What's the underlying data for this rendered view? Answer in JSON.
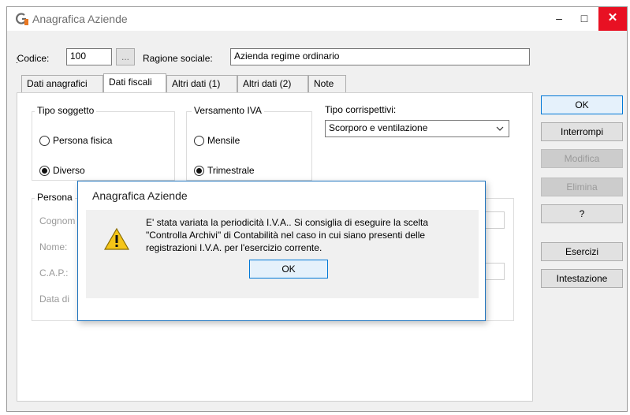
{
  "window": {
    "title": "Anagrafica Aziende",
    "app_logo": "G",
    "minimize": "–",
    "maximize": "□",
    "close": "✕"
  },
  "header": {
    "code_label": "Codice:",
    "code_value": "100",
    "lookup_button": "...",
    "company_label": "Ragione sociale:",
    "company_value": "Azienda regime ordinario"
  },
  "tabs": [
    {
      "label": "Dati anagrafici",
      "active": false
    },
    {
      "label": "Dati fiscali",
      "active": true
    },
    {
      "label": "Altri dati (1)",
      "active": false
    },
    {
      "label": "Altri dati (2)",
      "active": false
    },
    {
      "label": "Note",
      "active": false
    }
  ],
  "fiscal": {
    "subject_type": {
      "title": "Tipo soggetto",
      "options": [
        "Persona fisica",
        "Diverso"
      ],
      "selected": "Diverso"
    },
    "vat_payment": {
      "title": "Versamento IVA",
      "options": [
        "Mensile",
        "Trimestrale"
      ],
      "selected": "Trimestrale"
    },
    "receipts_type": {
      "label": "Tipo corrispettivi:",
      "value": "Scorporo e ventilazione"
    },
    "person_group": {
      "title": "Persona",
      "fields": [
        "Cognom",
        "Nome:",
        "C.A.P.:",
        "Data di"
      ]
    }
  },
  "side_buttons": [
    {
      "label": "OK",
      "enabled": true
    },
    {
      "label": "Interrompi",
      "enabled": true
    },
    {
      "label": "Modifica",
      "enabled": false
    },
    {
      "label": "Elimina",
      "enabled": false
    },
    {
      "label": "?",
      "enabled": true
    },
    {
      "label": "Esercizi",
      "enabled": true
    },
    {
      "label": "Intestazione",
      "enabled": true
    }
  ],
  "dialog": {
    "title": "Anagrafica Aziende",
    "icon": "warning-icon",
    "message_line1": "E' stata variata la periodicità I.V.A.. Si consiglia di eseguire la scelta",
    "message_line2": "\"Controlla Archivi\" di Contabilità nel caso in cui siano presenti delle",
    "message_line3": "registrazioni I.V.A. per l'esercizio corrente.",
    "ok_label": "OK"
  },
  "colors": {
    "accent": "#0078d7",
    "close": "#e81123",
    "warning": "#f5c518"
  }
}
